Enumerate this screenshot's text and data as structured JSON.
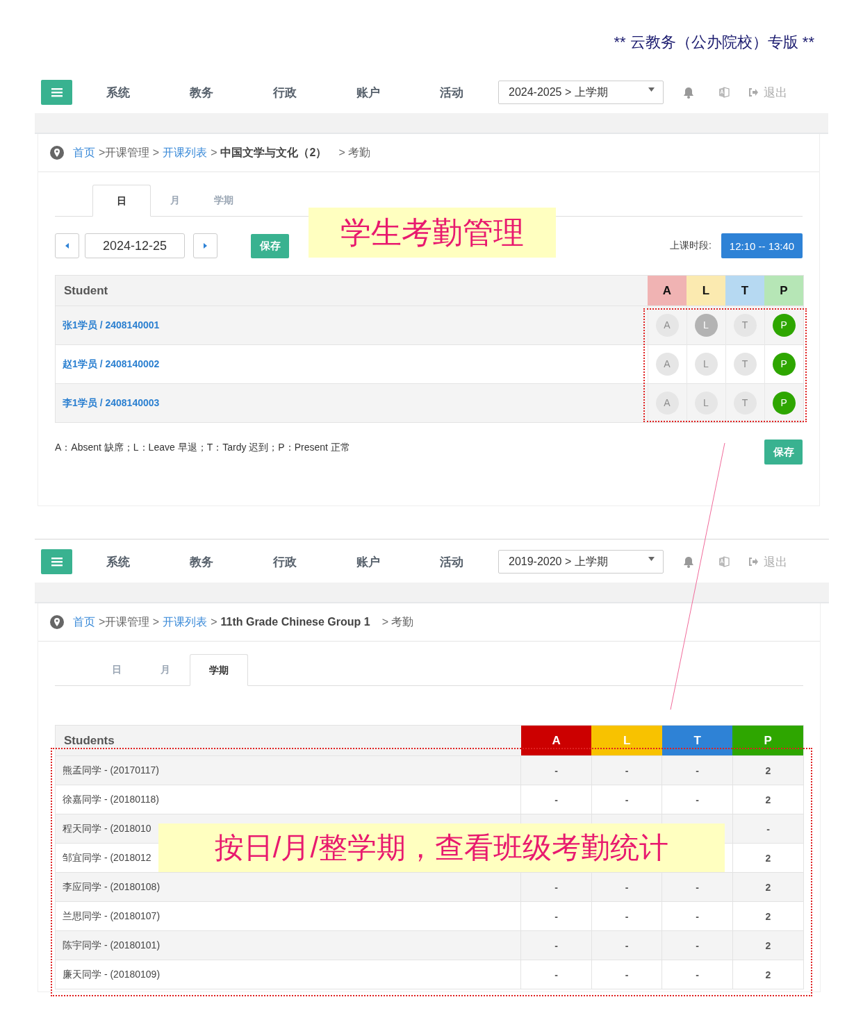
{
  "banner": "** 云教务（公办院校）专版 **",
  "panels": [
    {
      "kind": "daily",
      "nav": {
        "items": [
          "系统",
          "教务",
          "行政",
          "账户",
          "活动"
        ],
        "term": "2024-2025 > 上学期",
        "logout": "退出"
      },
      "breadcrumb": [
        {
          "text": "首页",
          "kind": "link"
        },
        {
          "text": ">开课管理 >",
          "kind": "plain"
        },
        {
          "text": "开课列表",
          "kind": "link"
        },
        {
          "text": ">",
          "kind": "plain"
        },
        {
          "text": "中国文学与文化（2）",
          "kind": "bold"
        },
        {
          "text": "> 考勤",
          "kind": "plain"
        }
      ],
      "tabs": [
        {
          "label": "日",
          "selected": true
        },
        {
          "label": "月",
          "selected": false
        },
        {
          "label": "学期",
          "selected": false
        }
      ],
      "toolbar": {
        "date": "2024-12-25",
        "save": "保存",
        "period_label": "上课时段:",
        "period": "12:10 -- 13:40"
      },
      "table": {
        "name_header": "Student",
        "columns": [
          {
            "label": "A",
            "color": "#f0b3b3"
          },
          {
            "label": "L",
            "color": "#fbeab0"
          },
          {
            "label": "T",
            "color": "#b6d9f2"
          },
          {
            "label": "P",
            "color": "#b6e6b6"
          }
        ],
        "rows": [
          {
            "name": "张1学员 / 2408140001",
            "marks": [
              {
                "label": "A",
                "selected": false
              },
              {
                "label": "L",
                "selected": true
              },
              {
                "label": "T",
                "selected": false
              },
              {
                "label": "P",
                "selected": true
              }
            ]
          },
          {
            "name": "赵1学员 / 2408140002",
            "marks": [
              {
                "label": "A",
                "selected": false
              },
              {
                "label": "L",
                "selected": false
              },
              {
                "label": "T",
                "selected": false
              },
              {
                "label": "P",
                "selected": true
              }
            ]
          },
          {
            "name": "李1学员 / 2408140003",
            "marks": [
              {
                "label": "A",
                "selected": false
              },
              {
                "label": "L",
                "selected": false
              },
              {
                "label": "T",
                "selected": false
              },
              {
                "label": "P",
                "selected": true
              }
            ]
          }
        ]
      },
      "legend": "A：Absent 缺席；L：Leave 早退；T：Tardy 迟到；P：Present 正常",
      "save": "保存"
    },
    {
      "kind": "term",
      "nav": {
        "items": [
          "系统",
          "教务",
          "行政",
          "账户",
          "活动"
        ],
        "term": "2019-2020 > 上学期",
        "logout": "退出"
      },
      "breadcrumb": [
        {
          "text": "首页",
          "kind": "link"
        },
        {
          "text": ">开课管理 >",
          "kind": "plain"
        },
        {
          "text": "开课列表",
          "kind": "link"
        },
        {
          "text": ">",
          "kind": "plain"
        },
        {
          "text": "11th Grade Chinese Group 1",
          "kind": "bold"
        },
        {
          "text": "> 考勤",
          "kind": "plain"
        }
      ],
      "tabs": [
        {
          "label": "日",
          "selected": false
        },
        {
          "label": "月",
          "selected": false
        },
        {
          "label": "学期",
          "selected": true
        }
      ],
      "table": {
        "name_header": "Students",
        "columns": [
          {
            "label": "A",
            "color": "#cc0000"
          },
          {
            "label": "L",
            "color": "#f8c200"
          },
          {
            "label": "T",
            "color": "#2e82d6"
          },
          {
            "label": "P",
            "color": "#2ea600"
          }
        ],
        "rows": [
          {
            "name": "熊孟同学 - (20170117)",
            "values": {
              "A": "-",
              "L": "-",
              "T": "-",
              "P": "2"
            }
          },
          {
            "name": "徐嘉同学 - (20180118)",
            "values": {
              "A": "-",
              "L": "-",
              "T": "-",
              "P": "2"
            }
          },
          {
            "name": "程天同学 - (2018010",
            "values": {
              "P": "-"
            }
          },
          {
            "name": "邹宜同学 - (2018012",
            "values": {
              "P": "2"
            }
          },
          {
            "name": "李应同学 - (20180108)",
            "values": {
              "A": "-",
              "L": "-",
              "T": "-",
              "P": "2"
            }
          },
          {
            "name": "兰思同学 - (20180107)",
            "values": {
              "A": "-",
              "L": "-",
              "T": "-",
              "P": "2"
            }
          },
          {
            "name": "陈宇同学 - (20180101)",
            "values": {
              "A": "-",
              "L": "-",
              "T": "-",
              "P": "2"
            }
          },
          {
            "name": "廉天同学 - (20180109)",
            "values": {
              "A": "-",
              "L": "-",
              "T": "-",
              "P": "2"
            }
          }
        ]
      }
    }
  ],
  "callouts": [
    "学生考勤管理",
    "按日/月/整学期，查看班级考勤统计"
  ]
}
